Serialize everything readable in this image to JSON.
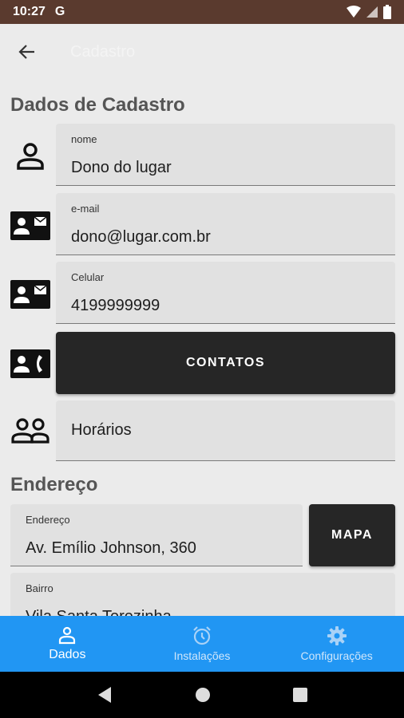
{
  "status": {
    "time": "10:27",
    "g_label": "G"
  },
  "appbar": {
    "title": "Cadastro"
  },
  "sections": {
    "cadastro_title": "Dados de Cadastro",
    "endereco_title": "Endereço"
  },
  "fields": {
    "nome": {
      "label": "nome",
      "value": "Dono do lugar"
    },
    "email": {
      "label": "e-mail",
      "value": "dono@lugar.com.br"
    },
    "celular": {
      "label": "Celular",
      "value": "4199999999"
    },
    "horarios": {
      "value": "Horários"
    },
    "endereco": {
      "label": "Endereço",
      "value": "Av. Emílio Johnson, 360"
    },
    "bairro": {
      "label": "Bairro",
      "value": "Vila Santa Terezinha"
    }
  },
  "buttons": {
    "contatos": "CONTATOS",
    "mapa": "MAPA"
  },
  "bottom_nav": [
    {
      "label": "Dados",
      "icon": "person-icon",
      "active": true
    },
    {
      "label": "Instalações",
      "icon": "alarm-icon",
      "active": false
    },
    {
      "label": "Configurações",
      "icon": "gear-icon",
      "active": false
    }
  ],
  "colors": {
    "accent": "#2196f3",
    "status_bar": "#5a3a2e",
    "button_dark": "#262626"
  }
}
